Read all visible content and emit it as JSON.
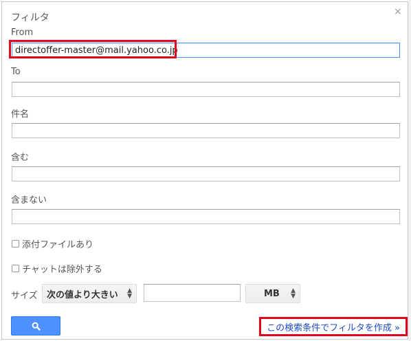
{
  "dialog": {
    "title": "フィルタ",
    "close_label": "×"
  },
  "from": {
    "label": "From",
    "value": "directoffer-master@mail.yahoo.co.jp"
  },
  "to": {
    "label": "To",
    "value": ""
  },
  "subject": {
    "label": "件名",
    "value": ""
  },
  "has_words": {
    "label": "含む",
    "value": ""
  },
  "doesnt_have": {
    "label": "含まない",
    "value": ""
  },
  "has_attachment": {
    "label": "添付ファイルあり",
    "checked": false
  },
  "exclude_chats": {
    "label": "チャットは除外する",
    "checked": false
  },
  "size": {
    "label": "サイズ",
    "operator": "次の値より大きい",
    "value": "",
    "unit": "MB"
  },
  "actions": {
    "search_icon": "search-icon",
    "create_filter": "この検索条件でフィルタを作成 »"
  },
  "colors": {
    "accent": "#4d90fe",
    "link": "#1a4cc6",
    "highlight": "#e0061e"
  }
}
